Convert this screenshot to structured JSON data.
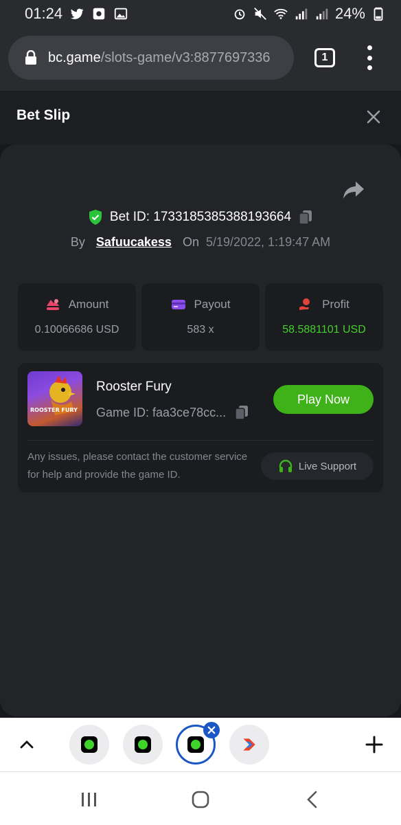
{
  "status_bar": {
    "time": "01:24",
    "battery": "24%",
    "left_icons": [
      "twitter-icon",
      "app-notification-icon",
      "gallery-icon"
    ],
    "right_icons": [
      "alarm-icon",
      "mute-icon",
      "wifi-icon",
      "signal-icon",
      "signal-icon",
      "battery-icon"
    ]
  },
  "browser": {
    "url_host": "bc.game",
    "url_path": "/slots-game/v3:8877697336",
    "tab_count": "1"
  },
  "bet_slip": {
    "title": "Bet Slip",
    "bet_id_label": "Bet ID: 1733185385388193664",
    "by_label": "By",
    "username": "Safuucakess",
    "on_label": "On",
    "date": "5/19/2022, 1:19:47 AM"
  },
  "stats": {
    "amount_label": "Amount",
    "amount_value": "0.10066686 USD",
    "payout_label": "Payout",
    "payout_value": "583 x",
    "profit_label": "Profit",
    "profit_value": "58.5881101 USD"
  },
  "game": {
    "thumb_title": "ROOSTER FURY",
    "name": "Rooster Fury",
    "game_id": "Game ID: faa3ce78cc...",
    "play_label": "Play Now",
    "help_text": "Any issues, please contact the customer service for help and provide the game ID.",
    "support_label": "Live Support"
  },
  "colors": {
    "accent_green": "#3fb21a",
    "profit_green": "#43d02a",
    "panel_bg": "#232428",
    "card_bg": "#1b1c20",
    "tab_active": "#1a56c6"
  }
}
